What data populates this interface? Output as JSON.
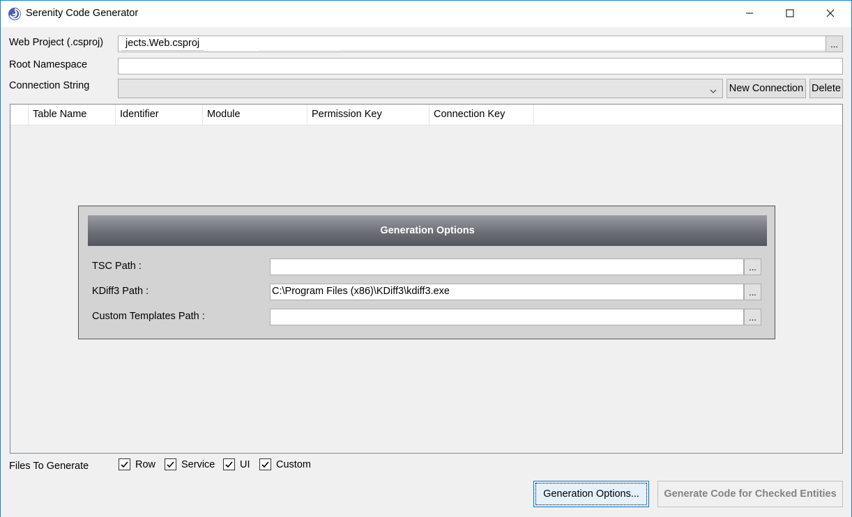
{
  "window": {
    "title": "Serenity Code Generator"
  },
  "form": {
    "web_project_label": "Web Project (.csproj)",
    "web_project_value": "jects.Web.csproj",
    "browse_label": "...",
    "root_namespace_label": "Root Namespace",
    "root_namespace_value": "",
    "connection_string_label": "Connection String",
    "connection_string_value": "",
    "new_connection_label": "New Connection",
    "delete_label": "Delete"
  },
  "grid": {
    "columns": [
      "Table Name",
      "Identifier",
      "Module",
      "Permission Key",
      "Connection Key"
    ],
    "rows": []
  },
  "generation_options": {
    "header": "Generation Options",
    "tsc_label": "TSC Path :",
    "tsc_value": "",
    "kdiff_label": "KDiff3 Path :",
    "kdiff_value": "C:\\Program Files (x86)\\KDiff3\\kdiff3.exe",
    "templates_label": "Custom Templates Path :",
    "templates_value": "",
    "browse_label": "..."
  },
  "files_to_generate": {
    "label": "Files To Generate",
    "items": [
      {
        "label": "Row",
        "checked": true
      },
      {
        "label": "Service",
        "checked": true
      },
      {
        "label": "UI",
        "checked": true
      },
      {
        "label": "Custom",
        "checked": true
      }
    ]
  },
  "actions": {
    "generation_options_label": "Generation Options...",
    "generate_code_label": "Generate Code for Checked Entities"
  },
  "colors": {
    "window_border": "#1883d7",
    "focus_button_bg": "#e5f1fb",
    "focus_button_border": "#0078d7",
    "disabled_text": "#838383"
  }
}
